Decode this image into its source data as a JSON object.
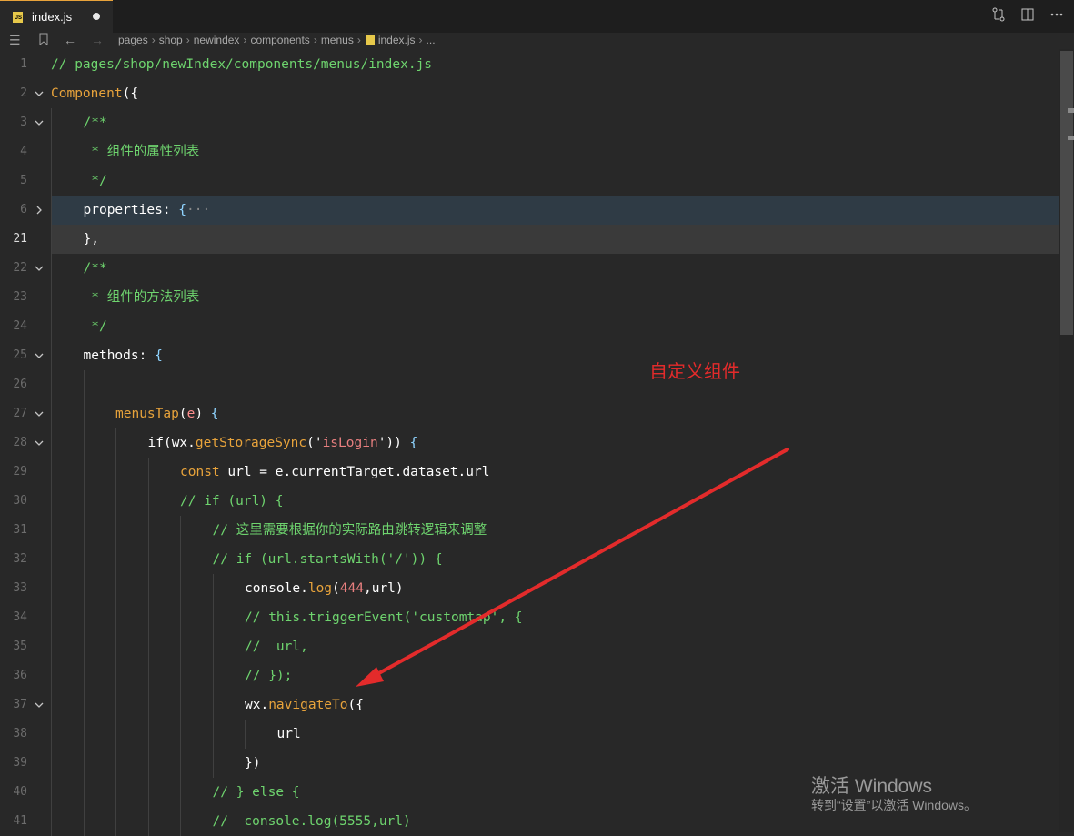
{
  "tab": {
    "filename": "index.js",
    "icon": "js-file-icon",
    "icon_text": "JS"
  },
  "actions": [
    "compare-icon",
    "split-editor-icon",
    "more-actions-icon"
  ],
  "breadcrumb": {
    "parts": [
      "pages",
      "shop",
      "newindex",
      "components",
      "menus",
      "index.js",
      "..."
    ]
  },
  "lines": [
    {
      "num": "1",
      "fold": "none",
      "current": false,
      "indent": 0,
      "tokens": [
        {
          "t": "// pages/shop/newIndex/components/menus/index.js",
          "c": "com"
        }
      ]
    },
    {
      "num": "2",
      "fold": "open",
      "current": false,
      "indent": 0,
      "tokens": [
        {
          "t": "Component",
          "c": "fn"
        },
        {
          "t": "(",
          "c": "def"
        },
        {
          "t": "{",
          "c": "def"
        }
      ]
    },
    {
      "num": "3",
      "fold": "open",
      "current": false,
      "indent": 1,
      "tokens": [
        {
          "t": "/**",
          "c": "com"
        }
      ]
    },
    {
      "num": "4",
      "fold": "none",
      "current": false,
      "indent": 1,
      "tokens": [
        {
          "t": " * 组件的属性列表",
          "c": "com"
        }
      ]
    },
    {
      "num": "5",
      "fold": "none",
      "current": false,
      "indent": 1,
      "tokens": [
        {
          "t": " */",
          "c": "com"
        }
      ]
    },
    {
      "num": "6",
      "fold": "closed",
      "current": false,
      "indent": 1,
      "tokens": [
        {
          "t": "properties",
          "c": "def"
        },
        {
          "t": ": ",
          "c": "def"
        },
        {
          "t": "{",
          "c": "punc"
        },
        {
          "t": "···",
          "c": "fold"
        }
      ]
    },
    {
      "num": "21",
      "fold": "none",
      "current": true,
      "indent": 1,
      "tokens": [
        {
          "t": "},",
          "c": "def"
        }
      ]
    },
    {
      "num": "22",
      "fold": "open",
      "current": false,
      "indent": 1,
      "tokens": [
        {
          "t": "/**",
          "c": "com"
        }
      ]
    },
    {
      "num": "23",
      "fold": "none",
      "current": false,
      "indent": 1,
      "tokens": [
        {
          "t": " * 组件的方法列表",
          "c": "com"
        }
      ]
    },
    {
      "num": "24",
      "fold": "none",
      "current": false,
      "indent": 1,
      "tokens": [
        {
          "t": " */",
          "c": "com"
        }
      ]
    },
    {
      "num": "25",
      "fold": "open",
      "current": false,
      "indent": 1,
      "tokens": [
        {
          "t": "methods",
          "c": "def"
        },
        {
          "t": ": ",
          "c": "def"
        },
        {
          "t": "{",
          "c": "punc"
        }
      ]
    },
    {
      "num": "26",
      "fold": "none",
      "current": false,
      "indent": 2,
      "tokens": []
    },
    {
      "num": "27",
      "fold": "open",
      "current": false,
      "indent": 2,
      "tokens": [
        {
          "t": "menusTap",
          "c": "fn"
        },
        {
          "t": "(",
          "c": "def"
        },
        {
          "t": "e",
          "c": "param"
        },
        {
          "t": ") ",
          "c": "def"
        },
        {
          "t": "{",
          "c": "punc"
        }
      ]
    },
    {
      "num": "28",
      "fold": "open",
      "current": false,
      "indent": 3,
      "tokens": [
        {
          "t": "if",
          "c": "def"
        },
        {
          "t": "(wx.",
          "c": "def"
        },
        {
          "t": "getStorageSync",
          "c": "fn"
        },
        {
          "t": "('",
          "c": "def"
        },
        {
          "t": "isLogin",
          "c": "str"
        },
        {
          "t": "')) ",
          "c": "def"
        },
        {
          "t": "{",
          "c": "punc"
        }
      ]
    },
    {
      "num": "29",
      "fold": "none",
      "current": false,
      "indent": 4,
      "tokens": [
        {
          "t": "const ",
          "c": "kw"
        },
        {
          "t": "url = e.currentTarget.dataset.url",
          "c": "def"
        }
      ]
    },
    {
      "num": "30",
      "fold": "none",
      "current": false,
      "indent": 4,
      "tokens": [
        {
          "t": "// if (url) {",
          "c": "com"
        }
      ]
    },
    {
      "num": "31",
      "fold": "none",
      "current": false,
      "indent": 5,
      "tokens": [
        {
          "t": "// 这里需要根据你的实际路由跳转逻辑来调整",
          "c": "com"
        }
      ]
    },
    {
      "num": "32",
      "fold": "none",
      "current": false,
      "indent": 5,
      "tokens": [
        {
          "t": "// if (url.startsWith('/')) {",
          "c": "com"
        }
      ]
    },
    {
      "num": "33",
      "fold": "none",
      "current": false,
      "indent": 6,
      "tokens": [
        {
          "t": "console.",
          "c": "def"
        },
        {
          "t": "log",
          "c": "fn"
        },
        {
          "t": "(",
          "c": "def"
        },
        {
          "t": "444",
          "c": "num"
        },
        {
          "t": ",url)",
          "c": "def"
        }
      ]
    },
    {
      "num": "34",
      "fold": "none",
      "current": false,
      "indent": 6,
      "tokens": [
        {
          "t": "// this.triggerEvent('customtap', {",
          "c": "com"
        }
      ]
    },
    {
      "num": "35",
      "fold": "none",
      "current": false,
      "indent": 6,
      "tokens": [
        {
          "t": "//  url,",
          "c": "com"
        }
      ]
    },
    {
      "num": "36",
      "fold": "none",
      "current": false,
      "indent": 6,
      "tokens": [
        {
          "t": "// });",
          "c": "com"
        }
      ]
    },
    {
      "num": "37",
      "fold": "open",
      "current": false,
      "indent": 6,
      "tokens": [
        {
          "t": "wx.",
          "c": "def"
        },
        {
          "t": "navigateTo",
          "c": "fn"
        },
        {
          "t": "({",
          "c": "def"
        }
      ]
    },
    {
      "num": "38",
      "fold": "none",
      "current": false,
      "indent": 7,
      "tokens": [
        {
          "t": "url",
          "c": "def"
        }
      ]
    },
    {
      "num": "39",
      "fold": "none",
      "current": false,
      "indent": 6,
      "tokens": [
        {
          "t": "})",
          "c": "def"
        }
      ]
    },
    {
      "num": "40",
      "fold": "none",
      "current": false,
      "indent": 5,
      "tokens": [
        {
          "t": "// } else {",
          "c": "com"
        }
      ]
    },
    {
      "num": "41",
      "fold": "none",
      "current": false,
      "indent": 5,
      "tokens": [
        {
          "t": "//  console.log(5555,url)",
          "c": "com"
        }
      ]
    }
  ],
  "annotation": {
    "text": "自定义组件",
    "color": "#e32b2b"
  },
  "watermark": {
    "title": "激活 Windows",
    "subtitle": "转到“设置”以激活 Windows。"
  },
  "colors": {
    "comment": "#6ed46e",
    "function": "#e8a33b",
    "string": "#e87f7f",
    "background": "#282828"
  }
}
